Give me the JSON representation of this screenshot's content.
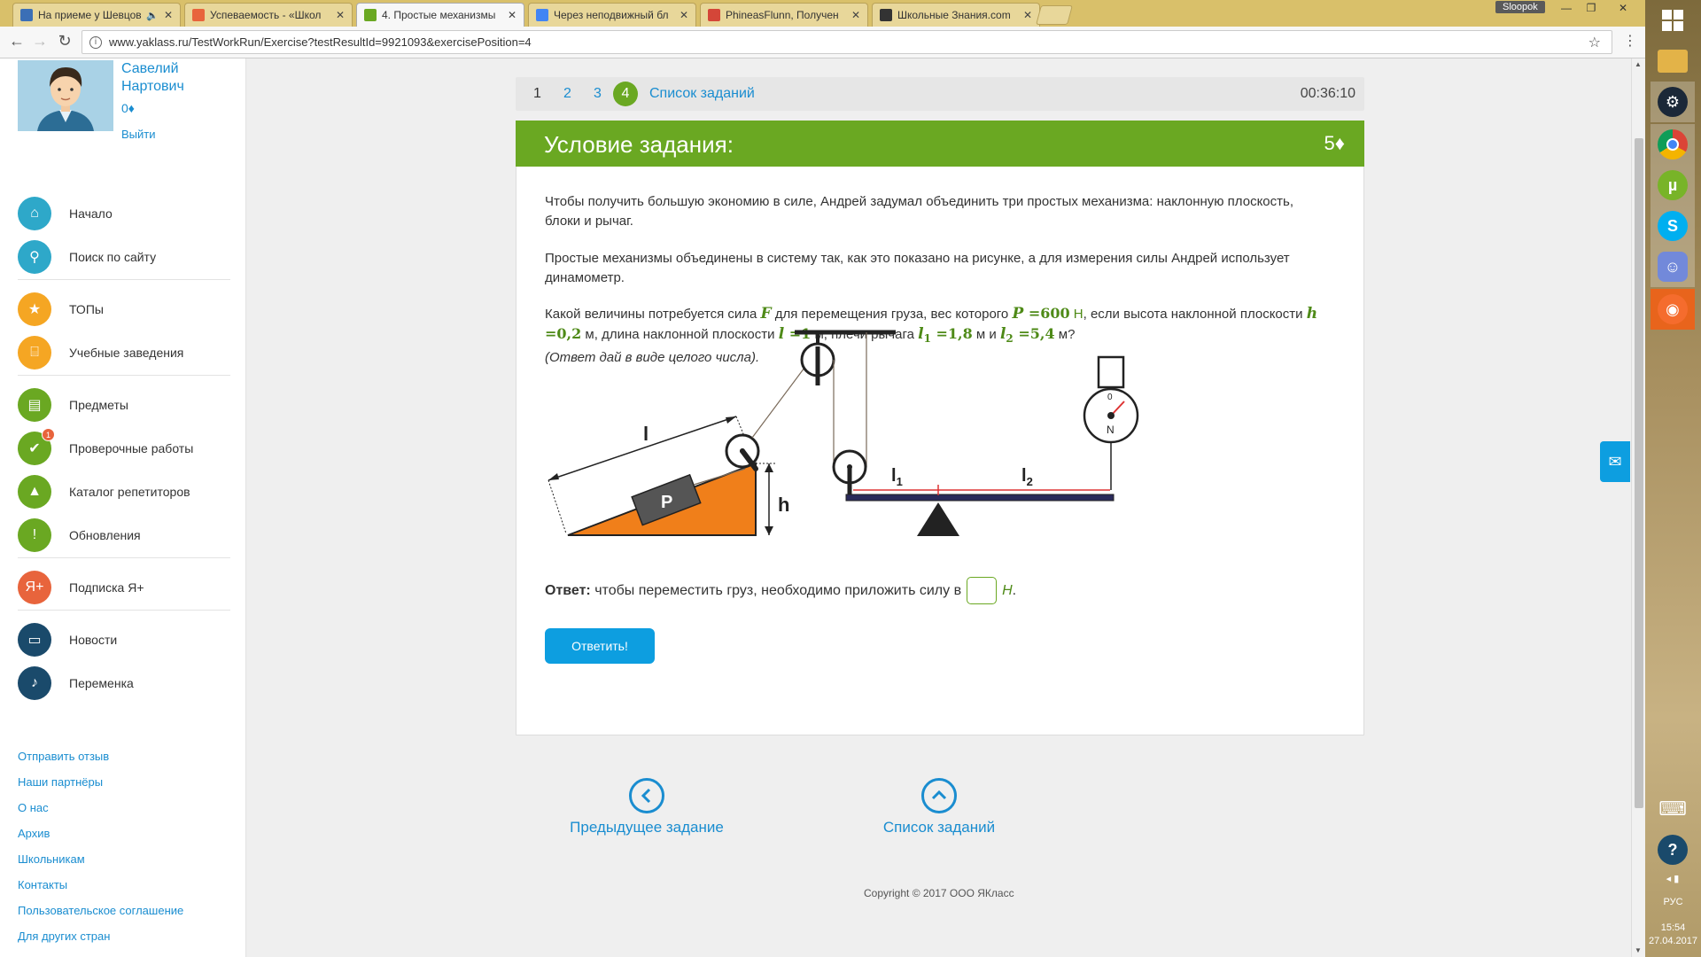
{
  "browser": {
    "tabs": [
      {
        "title": "На приеме у Шевцов",
        "active": false,
        "favicon_color": "#3b6fb6",
        "has_speaker": true
      },
      {
        "title": "Успеваемость - «Школ",
        "active": false,
        "favicon_color": "#e8643c",
        "has_speaker": false
      },
      {
        "title": "4. Простые механизмы",
        "active": true,
        "favicon_color": "#6aa822",
        "has_speaker": false
      },
      {
        "title": "Через неподвижный бл",
        "active": false,
        "favicon_color": "#4285f4",
        "has_speaker": false
      },
      {
        "title": "PhineasFlunn, Получен",
        "active": false,
        "favicon_color": "#d44638",
        "has_speaker": false
      },
      {
        "title": "Школьные Знания.com",
        "active": false,
        "favicon_color": "#333333",
        "has_speaker": false
      }
    ],
    "profile_name": "Sloopok",
    "close_glyph": "✕",
    "url": "www.yaklass.ru/TestWorkRun/Exercise?testResultId=9921093&exercisePosition=4"
  },
  "user": {
    "name": "Савелий Нартович",
    "points": "0♦",
    "logout": "Выйти"
  },
  "sidebar": {
    "groups": [
      [
        {
          "label": "Начало",
          "icon": "home-icon",
          "color": "#2ea8c9"
        },
        {
          "label": "Поиск по сайту",
          "icon": "search-icon",
          "color": "#2ea8c9"
        }
      ],
      [
        {
          "label": "ТОПы",
          "icon": "star-icon",
          "color": "#f5a623"
        },
        {
          "label": "Учебные заведения",
          "icon": "school-icon",
          "color": "#f5a623"
        }
      ],
      [
        {
          "label": "Предметы",
          "icon": "book-icon",
          "color": "#6aa822"
        },
        {
          "label": "Проверочные работы",
          "icon": "check-icon",
          "color": "#6aa822",
          "badge": "1"
        },
        {
          "label": "Каталог репетиторов",
          "icon": "graduation-cap-icon",
          "color": "#6aa822"
        },
        {
          "label": "Обновления",
          "icon": "exclamation-icon",
          "color": "#6aa822"
        }
      ],
      [
        {
          "label": "Подписка Я+",
          "icon": "yaplus-icon",
          "color": "#e8643c"
        }
      ],
      [
        {
          "label": "Новости",
          "icon": "chat-icon",
          "color": "#1a4a6b"
        },
        {
          "label": "Переменка",
          "icon": "bell-icon",
          "color": "#1a4a6b"
        }
      ]
    ],
    "footer_links": [
      "Отправить отзыв",
      "Наши партнёры",
      "О нас",
      "Архив",
      "Школьникам",
      "Контакты",
      "Пользовательское соглашение",
      "Для других стран"
    ]
  },
  "steps": {
    "items": [
      "1",
      "2",
      "3"
    ],
    "active": "4",
    "list_link": "Список заданий",
    "timer": "00:36:10"
  },
  "task": {
    "title": "Условие задания:",
    "points": "5♦",
    "para1": "Чтобы получить большую экономию в силе, Андрей задумал объединить три простых механизма: наклонную плоскость, блоки и рычаг.",
    "para2": "Простые механизмы объединены в систему так, как это показано на рисунке, а для измерения силы Андрей использует динамометр.",
    "q": {
      "t1": "Какой величины потребуется сила ",
      "F": "F",
      "t2": " для перемещения груза, вес которого ",
      "P": "P",
      "Pv": " =600",
      "Pu": " Н",
      "t3": ", если высота наклонной плоскости ",
      "h": "h",
      "hv": " =0,2",
      "t4": " м, длина наклонной плоскости ",
      "l": "l",
      "lv": " =1",
      "t5": " м, плечи рычага ",
      "l1": "l",
      "l1s": "1",
      "l1v": " =1,8",
      "t6": " м и ",
      "l2": "l",
      "l2s": "2",
      "l2v": " =5,4",
      "t7": " м?"
    },
    "note": "(Ответ дай в виде целого числа).",
    "diagram_labels": {
      "l": "l",
      "P": "P",
      "h": "h",
      "l1": "l",
      "l1s": "1",
      "l2": "l",
      "l2s": "2",
      "zero": "0",
      "N": "N"
    },
    "answer_label": "Ответ:",
    "answer_text": " чтобы переместить груз, необходимо приложить силу в",
    "answer_unit": "Н",
    "answer_end": ".",
    "submit": "Ответить!"
  },
  "nav": {
    "prev": "Предыдущее задание",
    "list": "Список заданий"
  },
  "copyright": "Copyright © 2017 ООО ЯКласс",
  "tray": {
    "lang": "РУС",
    "time": "15:54",
    "date": "27.04.2017"
  },
  "colors": {
    "accent_green": "#6aa822",
    "link_blue": "#1a8dd0",
    "button_blue": "#0d9ee0",
    "ramp_orange": "#f07f1a"
  }
}
